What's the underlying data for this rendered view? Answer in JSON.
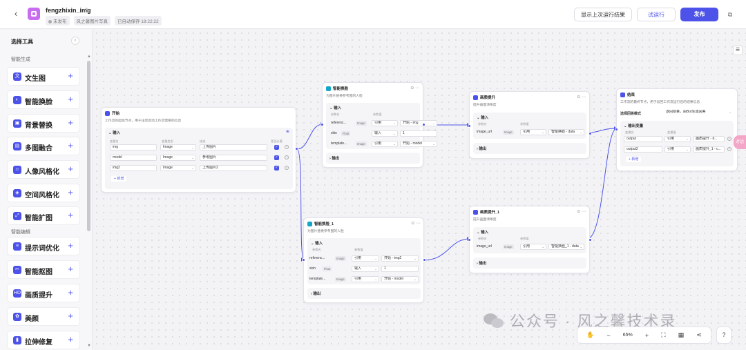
{
  "header": {
    "app_name": "fengzhixin_img",
    "status": "未发布",
    "author": "风之馨图片写真",
    "autosave": "已自动保存 18:22:22",
    "show_last_result": "显示上次运行结果",
    "test_run": "试运行",
    "publish": "发布"
  },
  "sidebar": {
    "title": "选择工具",
    "section_generate": "智能生成",
    "section_edit": "智能编辑",
    "tools": [
      {
        "label": "文生图",
        "icon": "文"
      },
      {
        "label": "智能换脸",
        "icon": "◐"
      },
      {
        "label": "背景替换",
        "icon": "▣"
      },
      {
        "label": "多图融合",
        "icon": "▤"
      },
      {
        "label": "人像风格化",
        "icon": "☺"
      },
      {
        "label": "空间风格化",
        "icon": "◈"
      },
      {
        "label": "智能扩图",
        "icon": "⤢"
      },
      {
        "label": "提示词优化",
        "icon": "≡"
      },
      {
        "label": "智能抠图",
        "icon": "✂"
      },
      {
        "label": "画质提升",
        "icon": "HD"
      },
      {
        "label": "美颜",
        "icon": "✿"
      },
      {
        "label": "拉伸修复",
        "icon": "▮"
      }
    ]
  },
  "nodes": {
    "start": {
      "title": "开始",
      "desc": "工作流的起始节点，用于设定启动工作流需要的信息",
      "input_section": "输入",
      "col_name": "变量名",
      "col_type": "变量类型",
      "col_desc": "描述",
      "col_required": "是否必要",
      "rows": [
        {
          "name": "img",
          "type": "Image",
          "desc": "上传图片"
        },
        {
          "name": "model",
          "type": "Image",
          "desc": "参考图片"
        },
        {
          "name": "img2",
          "type": "Image",
          "desc": "上传图片2"
        }
      ],
      "add": "新增"
    },
    "faceswap1": {
      "title": "智能换脸",
      "desc": "为图片替换参考图的人脸",
      "input_section": "输入",
      "col_name": "参数名",
      "col_value": "参数值",
      "rows": [
        {
          "name": "referenc...",
          "tag": "Image",
          "mode": "引用",
          "value": "开始 - img"
        },
        {
          "name": "skin",
          "tag": "Float",
          "mode": "输入",
          "value": "1"
        },
        {
          "name": "template...",
          "tag": "Image",
          "mode": "引用",
          "value": "开始 - model"
        }
      ],
      "output_section": "输出"
    },
    "faceswap2": {
      "title": "智能换脸_1",
      "desc": "为图片替换参考图的人脸",
      "input_section": "输入",
      "col_name": "参数名",
      "col_value": "参数值",
      "rows": [
        {
          "name": "referenc...",
          "tag": "Image",
          "mode": "引用",
          "value": "开始 - img2"
        },
        {
          "name": "skin",
          "tag": "Float",
          "mode": "输入",
          "value": "1"
        },
        {
          "name": "template...",
          "tag": "Image",
          "mode": "引用",
          "value": "开始 - model"
        }
      ],
      "output_section": "输出"
    },
    "enhance1": {
      "title": "画质提升",
      "desc": "提升画面清晰度",
      "input_section": "输入",
      "col_name": "参数名",
      "col_value": "参数值",
      "rows": [
        {
          "name": "image_url",
          "tag": "Image",
          "mode": "引用",
          "value": "智能换脸 - data"
        }
      ],
      "output_section": "输出"
    },
    "enhance2": {
      "title": "画质提升_1",
      "desc": "提升画面清晰度",
      "input_section": "输入",
      "col_name": "参数名",
      "col_value": "参数值",
      "rows": [
        {
          "name": "image_url",
          "tag": "Image",
          "mode": "引用",
          "value": "智能换脸_1 - data"
        }
      ],
      "output_section": "输出"
    },
    "end": {
      "title": "结束",
      "desc": "工作流的最终节点，用于返回工作流运行后的结果信息",
      "format_label": "选择回答模式",
      "format_value": "返回变量，由Bot生成回答",
      "output_section": "输出变量",
      "col_name": "变量名",
      "col_value": "变量值",
      "rows": [
        {
          "name": "output",
          "mode": "引用",
          "value": "画质提升 - d..."
        },
        {
          "name": "output2",
          "mode": "引用",
          "value": "画质提升_1 - c..."
        }
      ],
      "add": "新增"
    }
  },
  "toolbar": {
    "zoom": "65%"
  },
  "chat_bubble": "对话",
  "watermark": "公众号 · 风之馨技术录"
}
